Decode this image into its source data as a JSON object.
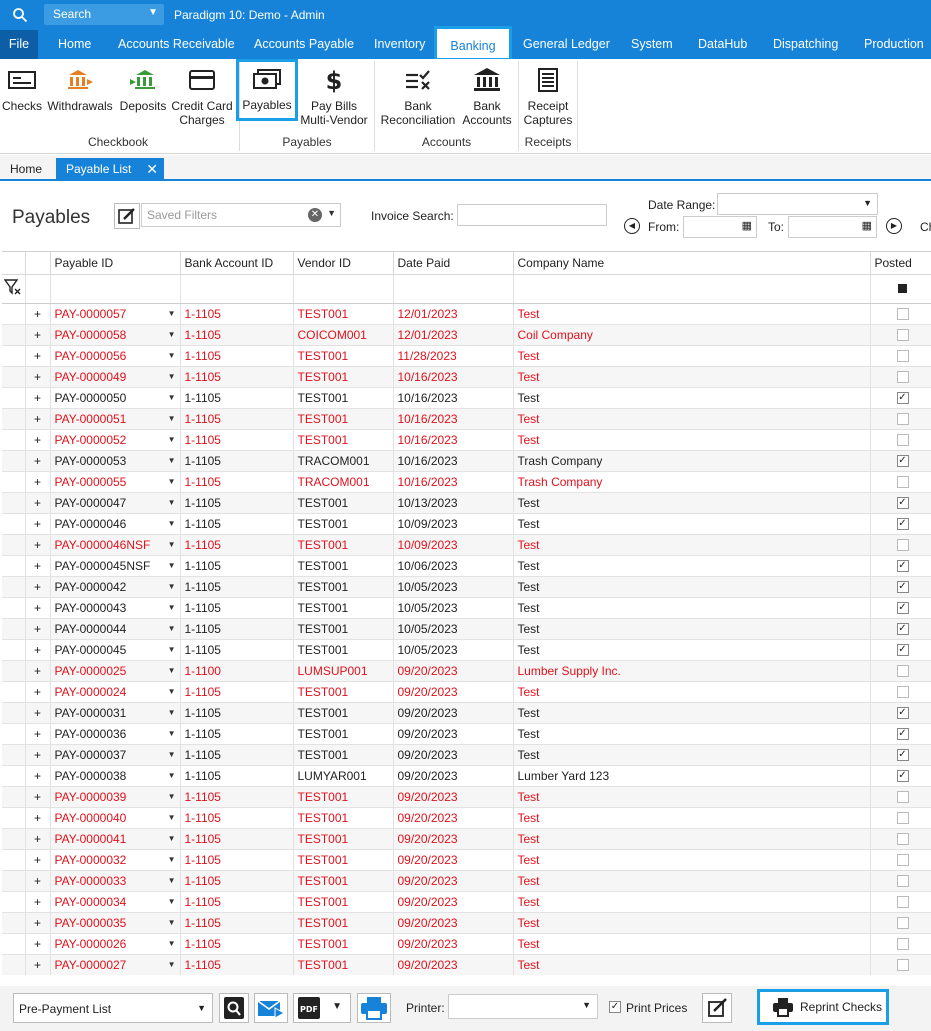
{
  "titlebar": {
    "search_label": "Search",
    "title": "Paradigm 10: Demo - Admin"
  },
  "menu": {
    "file": "File",
    "items": [
      "Home",
      "Accounts Receivable",
      "Accounts Payable",
      "Inventory",
      "Banking",
      "General Ledger",
      "System",
      "DataHub",
      "Dispatching",
      "Production"
    ]
  },
  "ribbon": {
    "checks": "Checks",
    "withdrawals": "Withdrawals",
    "deposits": "Deposits",
    "credit_card_1": "Credit Card",
    "credit_card_2": "Charges",
    "payables": "Payables",
    "pay_bills_1": "Pay Bills",
    "pay_bills_2": "Multi-Vendor",
    "bank_rec_1": "Bank",
    "bank_rec_2": "Reconciliation",
    "bank_acc_1": "Bank",
    "bank_acc_2": "Accounts",
    "receipt_1": "Receipt",
    "receipt_2": "Captures",
    "group_checkbook": "Checkbook",
    "group_payables": "Payables",
    "group_accounts": "Accounts",
    "group_receipts": "Receipts"
  },
  "tabs": {
    "home": "Home",
    "current": "Payable List",
    "close": "✕"
  },
  "toolbar": {
    "page_title": "Payables",
    "saved_filters_placeholder": "Saved Filters",
    "invoice_search_label": "Invoice Search:",
    "date_range_label": "Date Range:",
    "from_label": "From:",
    "to_label": "To:",
    "trailing": "Ch"
  },
  "columns": [
    "Payable ID",
    "Bank Account ID",
    "Vendor ID",
    "Date Paid",
    "Company Name",
    "Posted"
  ],
  "rows": [
    {
      "id": "PAY-0000057",
      "bank": "1-1105",
      "vendor": "TEST001",
      "date": "12/01/2023",
      "company": "Test",
      "posted": false
    },
    {
      "id": "PAY-0000058",
      "bank": "1-1105",
      "vendor": "COICOM001",
      "date": "12/01/2023",
      "company": "Coil Company",
      "posted": false
    },
    {
      "id": "PAY-0000056",
      "bank": "1-1105",
      "vendor": "TEST001",
      "date": "11/28/2023",
      "company": "Test",
      "posted": false
    },
    {
      "id": "PAY-0000049",
      "bank": "1-1105",
      "vendor": "TEST001",
      "date": "10/16/2023",
      "company": "Test",
      "posted": false
    },
    {
      "id": "PAY-0000050",
      "bank": "1-1105",
      "vendor": "TEST001",
      "date": "10/16/2023",
      "company": "Test",
      "posted": true
    },
    {
      "id": "PAY-0000051",
      "bank": "1-1105",
      "vendor": "TEST001",
      "date": "10/16/2023",
      "company": "Test",
      "posted": false
    },
    {
      "id": "PAY-0000052",
      "bank": "1-1105",
      "vendor": "TEST001",
      "date": "10/16/2023",
      "company": "Test",
      "posted": false
    },
    {
      "id": "PAY-0000053",
      "bank": "1-1105",
      "vendor": "TRACOM001",
      "date": "10/16/2023",
      "company": "Trash Company",
      "posted": true
    },
    {
      "id": "PAY-0000055",
      "bank": "1-1105",
      "vendor": "TRACOM001",
      "date": "10/16/2023",
      "company": "Trash Company",
      "posted": false
    },
    {
      "id": "PAY-0000047",
      "bank": "1-1105",
      "vendor": "TEST001",
      "date": "10/13/2023",
      "company": "Test",
      "posted": true
    },
    {
      "id": "PAY-0000046",
      "bank": "1-1105",
      "vendor": "TEST001",
      "date": "10/09/2023",
      "company": "Test",
      "posted": true
    },
    {
      "id": "PAY-0000046NSF",
      "bank": "1-1105",
      "vendor": "TEST001",
      "date": "10/09/2023",
      "company": "Test",
      "posted": false
    },
    {
      "id": "PAY-0000045NSF",
      "bank": "1-1105",
      "vendor": "TEST001",
      "date": "10/06/2023",
      "company": "Test",
      "posted": true
    },
    {
      "id": "PAY-0000042",
      "bank": "1-1105",
      "vendor": "TEST001",
      "date": "10/05/2023",
      "company": "Test",
      "posted": true
    },
    {
      "id": "PAY-0000043",
      "bank": "1-1105",
      "vendor": "TEST001",
      "date": "10/05/2023",
      "company": "Test",
      "posted": true
    },
    {
      "id": "PAY-0000044",
      "bank": "1-1105",
      "vendor": "TEST001",
      "date": "10/05/2023",
      "company": "Test",
      "posted": true
    },
    {
      "id": "PAY-0000045",
      "bank": "1-1105",
      "vendor": "TEST001",
      "date": "10/05/2023",
      "company": "Test",
      "posted": true
    },
    {
      "id": "PAY-0000025",
      "bank": "1-1100",
      "vendor": "LUMSUP001",
      "date": "09/20/2023",
      "company": "Lumber Supply Inc.",
      "posted": false
    },
    {
      "id": "PAY-0000024",
      "bank": "1-1105",
      "vendor": "TEST001",
      "date": "09/20/2023",
      "company": "Test",
      "posted": false
    },
    {
      "id": "PAY-0000031",
      "bank": "1-1105",
      "vendor": "TEST001",
      "date": "09/20/2023",
      "company": "Test",
      "posted": true
    },
    {
      "id": "PAY-0000036",
      "bank": "1-1105",
      "vendor": "TEST001",
      "date": "09/20/2023",
      "company": "Test",
      "posted": true
    },
    {
      "id": "PAY-0000037",
      "bank": "1-1105",
      "vendor": "TEST001",
      "date": "09/20/2023",
      "company": "Test",
      "posted": true
    },
    {
      "id": "PAY-0000038",
      "bank": "1-1105",
      "vendor": "LUMYAR001",
      "date": "09/20/2023",
      "company": "Lumber Yard 123",
      "posted": true
    },
    {
      "id": "PAY-0000039",
      "bank": "1-1105",
      "vendor": "TEST001",
      "date": "09/20/2023",
      "company": "Test",
      "posted": false
    },
    {
      "id": "PAY-0000040",
      "bank": "1-1105",
      "vendor": "TEST001",
      "date": "09/20/2023",
      "company": "Test",
      "posted": false
    },
    {
      "id": "PAY-0000041",
      "bank": "1-1105",
      "vendor": "TEST001",
      "date": "09/20/2023",
      "company": "Test",
      "posted": false
    },
    {
      "id": "PAY-0000032",
      "bank": "1-1105",
      "vendor": "TEST001",
      "date": "09/20/2023",
      "company": "Test",
      "posted": false
    },
    {
      "id": "PAY-0000033",
      "bank": "1-1105",
      "vendor": "TEST001",
      "date": "09/20/2023",
      "company": "Test",
      "posted": false
    },
    {
      "id": "PAY-0000034",
      "bank": "1-1105",
      "vendor": "TEST001",
      "date": "09/20/2023",
      "company": "Test",
      "posted": false
    },
    {
      "id": "PAY-0000035",
      "bank": "1-1105",
      "vendor": "TEST001",
      "date": "09/20/2023",
      "company": "Test",
      "posted": false
    },
    {
      "id": "PAY-0000026",
      "bank": "1-1105",
      "vendor": "TEST001",
      "date": "09/20/2023",
      "company": "Test",
      "posted": false
    },
    {
      "id": "PAY-0000027",
      "bank": "1-1105",
      "vendor": "TEST001",
      "date": "09/20/2023",
      "company": "Test",
      "posted": false
    }
  ],
  "footer": {
    "report_select": "Pre-Payment List",
    "printer_label": "Printer:",
    "print_prices_label": "Print Prices",
    "print_prices_checked": true,
    "reprint_label": "Reprint Checks"
  },
  "colors": {
    "accent": "#1683d8",
    "unposted_text": "#e0111b",
    "highlight": "#1a9fe6"
  }
}
